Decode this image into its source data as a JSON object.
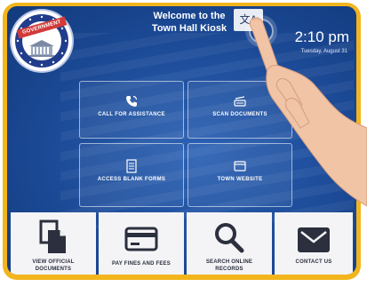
{
  "header": {
    "welcome_line1": "Welcome to the",
    "welcome_line2": "Town Hall Kiosk",
    "seal_text": "GOVERNMENT",
    "translate_icon": "translate-icon",
    "time": "2:10 pm",
    "date": "Tuesday, August 31"
  },
  "grid": [
    {
      "label": "CALL FOR ASSISTANCE",
      "icon": "phone-icon"
    },
    {
      "label": "SCAN DOCUMENTS",
      "icon": "scanner-icon"
    },
    {
      "label": "ACCESS BLANK FORMS",
      "icon": "document-icon"
    },
    {
      "label": "TOWN WEBSITE",
      "icon": "browser-icon"
    }
  ],
  "tiles": [
    {
      "line1": "VIEW OFFICIAL",
      "line2": "DOCUMENTS",
      "icon": "documents-icon"
    },
    {
      "line1": "PAY FINES AND FEES",
      "line2": "",
      "icon": "credit-card-icon"
    },
    {
      "line1": "SEARCH ONLINE",
      "line2": "RECORDS",
      "icon": "search-icon"
    },
    {
      "line1": "CONTACT US",
      "line2": "",
      "icon": "envelope-icon"
    }
  ],
  "colors": {
    "bezel": "#f3b51c",
    "screen": "#1c4a96",
    "tile_bg": "#f4f4f6",
    "icon_dark": "#2b2f3e"
  }
}
